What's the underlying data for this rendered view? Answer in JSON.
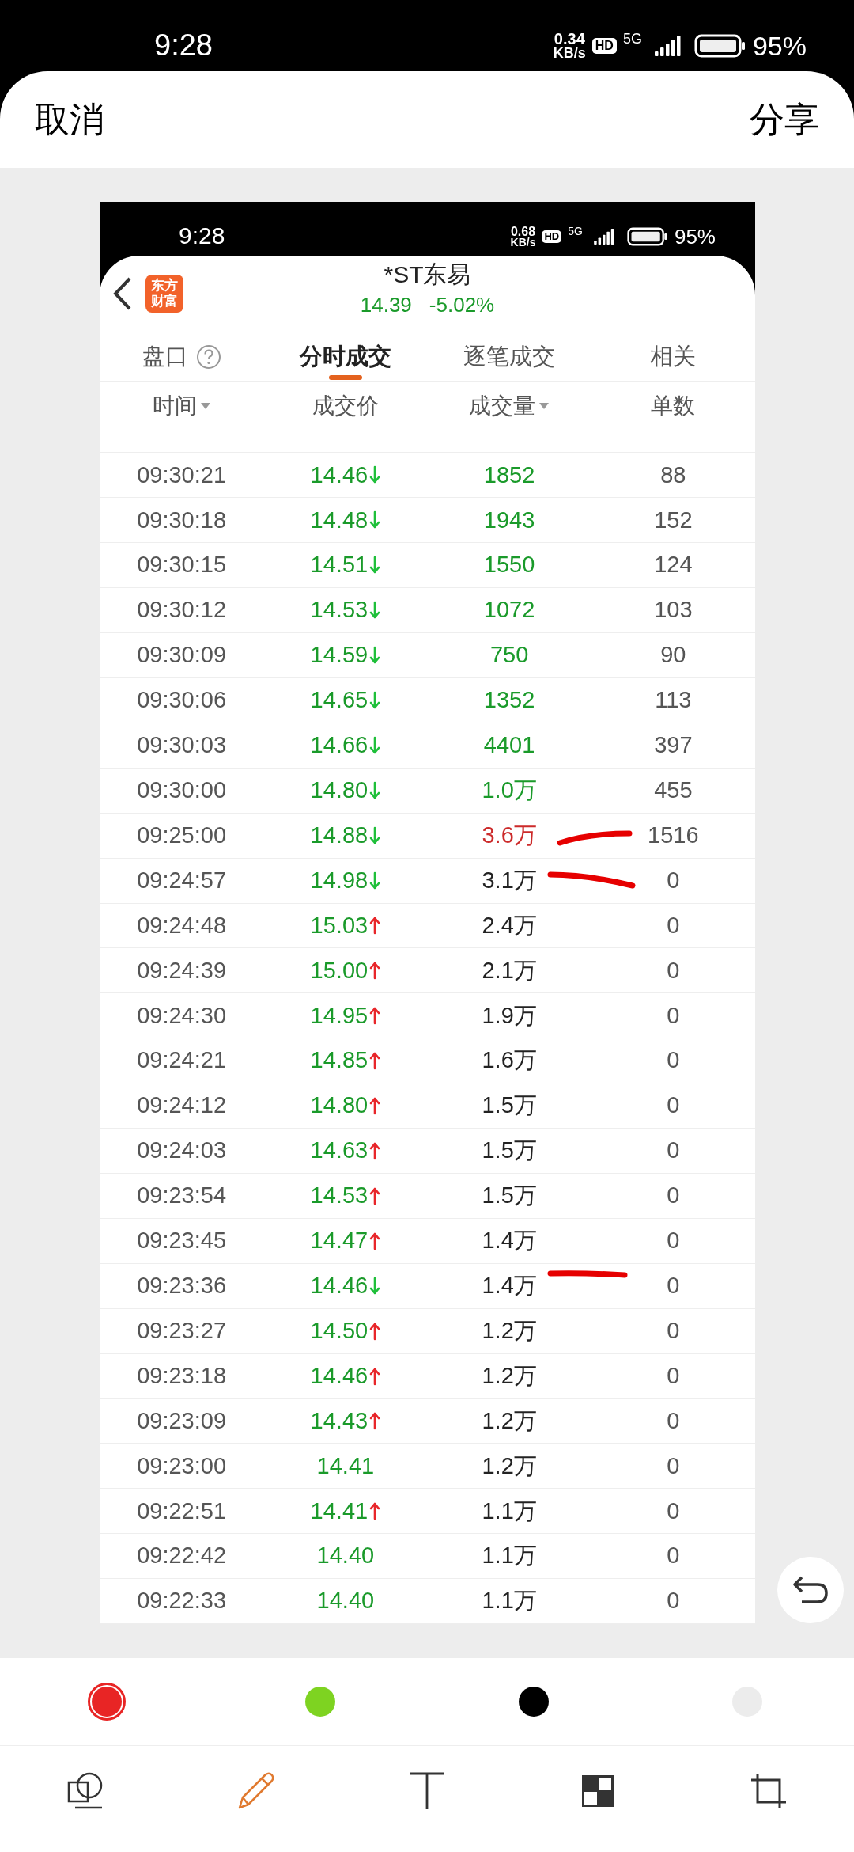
{
  "status_bar": {
    "time": "9:28",
    "speed_value": "0.34",
    "speed_unit": "KB/s",
    "hd": "HD",
    "network": "5G",
    "battery": "95%"
  },
  "header": {
    "cancel": "取消",
    "share": "分享"
  },
  "screenshot": {
    "status_bar": {
      "time": "9:28",
      "speed_value": "0.68",
      "speed_unit": "KB/s",
      "hd": "HD",
      "network": "5G",
      "battery": "95%"
    },
    "app_logo": "东方财富",
    "stock": {
      "name": "*ST东易",
      "price": "14.39",
      "change": "-5.02%"
    },
    "tabs": [
      {
        "label": "盘口",
        "help": true,
        "selected": false
      },
      {
        "label": "分时成交",
        "help": false,
        "selected": true
      },
      {
        "label": "逐笔成交",
        "help": false,
        "selected": false
      },
      {
        "label": "相关",
        "help": false,
        "selected": false
      }
    ],
    "columns": [
      {
        "label": "时间",
        "sortable": true
      },
      {
        "label": "成交价",
        "sortable": false
      },
      {
        "label": "成交量",
        "sortable": true
      },
      {
        "label": "单数",
        "sortable": false
      }
    ],
    "rows": [
      {
        "time": "09:30:21",
        "price": "14.46",
        "up": false,
        "down": true,
        "volume": "1852",
        "color": "#1a9a2a",
        "count": "88"
      },
      {
        "time": "09:30:18",
        "price": "14.48",
        "up": false,
        "down": true,
        "volume": "1943",
        "color": "#1a9a2a",
        "count": "152"
      },
      {
        "time": "09:30:15",
        "price": "14.51",
        "up": false,
        "down": true,
        "volume": "1550",
        "color": "#1a9a2a",
        "count": "124"
      },
      {
        "time": "09:30:12",
        "price": "14.53",
        "up": false,
        "down": true,
        "volume": "1072",
        "color": "#1a9a2a",
        "count": "103"
      },
      {
        "time": "09:30:09",
        "price": "14.59",
        "up": false,
        "down": true,
        "volume": "750",
        "color": "#1a9a2a",
        "count": "90"
      },
      {
        "time": "09:30:06",
        "price": "14.65",
        "up": false,
        "down": true,
        "volume": "1352",
        "color": "#1a9a2a",
        "count": "113"
      },
      {
        "time": "09:30:03",
        "price": "14.66",
        "up": false,
        "down": true,
        "volume": "4401",
        "color": "#1a9a2a",
        "count": "397"
      },
      {
        "time": "09:30:00",
        "price": "14.80",
        "up": false,
        "down": true,
        "volume": "1.0万",
        "color": "#1a9a2a",
        "count": "455"
      },
      {
        "time": "09:25:00",
        "price": "14.88",
        "up": false,
        "down": true,
        "volume": "3.6万",
        "color": "#cc2a2a",
        "count": "1516"
      },
      {
        "time": "09:24:57",
        "price": "14.98",
        "up": false,
        "down": true,
        "volume": "3.1万",
        "color": "#222222",
        "count": "0"
      },
      {
        "time": "09:24:48",
        "price": "15.03",
        "up": true,
        "down": false,
        "volume": "2.4万",
        "color": "#222222",
        "count": "0"
      },
      {
        "time": "09:24:39",
        "price": "15.00",
        "up": true,
        "down": false,
        "volume": "2.1万",
        "color": "#222222",
        "count": "0"
      },
      {
        "time": "09:24:30",
        "price": "14.95",
        "up": true,
        "down": false,
        "volume": "1.9万",
        "color": "#222222",
        "count": "0"
      },
      {
        "time": "09:24:21",
        "price": "14.85",
        "up": true,
        "down": false,
        "volume": "1.6万",
        "color": "#222222",
        "count": "0"
      },
      {
        "time": "09:24:12",
        "price": "14.80",
        "up": true,
        "down": false,
        "volume": "1.5万",
        "color": "#222222",
        "count": "0"
      },
      {
        "time": "09:24:03",
        "price": "14.63",
        "up": true,
        "down": false,
        "volume": "1.5万",
        "color": "#222222",
        "count": "0"
      },
      {
        "time": "09:23:54",
        "price": "14.53",
        "up": true,
        "down": false,
        "volume": "1.5万",
        "color": "#222222",
        "count": "0"
      },
      {
        "time": "09:23:45",
        "price": "14.47",
        "up": true,
        "down": false,
        "volume": "1.4万",
        "color": "#222222",
        "count": "0"
      },
      {
        "time": "09:23:36",
        "price": "14.46",
        "up": false,
        "down": true,
        "volume": "1.4万",
        "color": "#222222",
        "count": "0"
      },
      {
        "time": "09:23:27",
        "price": "14.50",
        "up": true,
        "down": false,
        "volume": "1.2万",
        "color": "#222222",
        "count": "0"
      },
      {
        "time": "09:23:18",
        "price": "14.46",
        "up": true,
        "down": false,
        "volume": "1.2万",
        "color": "#222222",
        "count": "0"
      },
      {
        "time": "09:23:09",
        "price": "14.43",
        "up": true,
        "down": false,
        "volume": "1.2万",
        "color": "#222222",
        "count": "0"
      },
      {
        "time": "09:23:00",
        "price": "14.41",
        "up": false,
        "down": false,
        "volume": "1.2万",
        "color": "#222222",
        "count": "0"
      },
      {
        "time": "09:22:51",
        "price": "14.41",
        "up": true,
        "down": false,
        "volume": "1.1万",
        "color": "#222222",
        "count": "0"
      },
      {
        "time": "09:22:42",
        "price": "14.40",
        "up": false,
        "down": false,
        "volume": "1.1万",
        "color": "#222222",
        "count": "0"
      },
      {
        "time": "09:22:33",
        "price": "14.40",
        "up": false,
        "down": false,
        "volume": "1.1万",
        "color": "#222222",
        "count": "0"
      }
    ]
  },
  "palette": [
    {
      "color": "#e82525",
      "selected": true
    },
    {
      "color": "#7ed321",
      "selected": false
    },
    {
      "color": "#000000",
      "selected": false
    },
    {
      "color": "#ececec",
      "selected": false
    }
  ],
  "tools": [
    {
      "kind": "shape",
      "selected": false
    },
    {
      "kind": "pen",
      "selected": true
    },
    {
      "kind": "text",
      "selected": false
    },
    {
      "kind": "mosaic",
      "selected": false
    },
    {
      "kind": "crop",
      "selected": false
    }
  ]
}
